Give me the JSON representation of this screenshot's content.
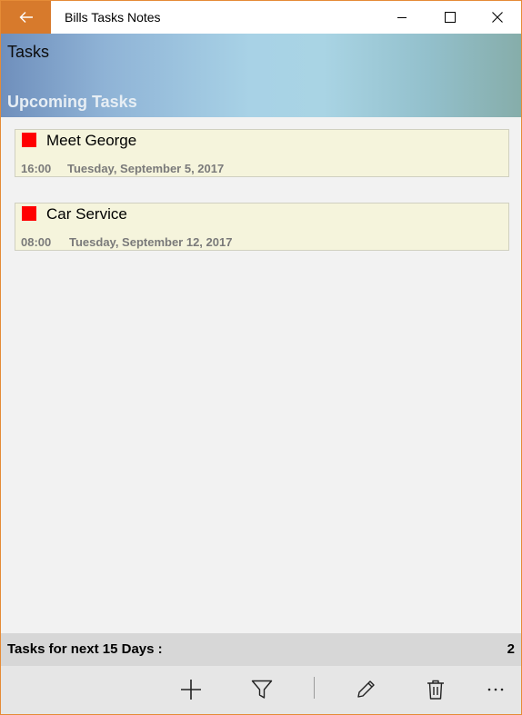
{
  "window": {
    "title": "Bills Tasks Notes"
  },
  "header": {
    "page_title": "Tasks",
    "section_title": "Upcoming Tasks"
  },
  "tasks": [
    {
      "name": "Meet George",
      "time": "16:00",
      "date": "Tuesday, September 5, 2017",
      "flag_color": "#ff0000"
    },
    {
      "name": "Car Service",
      "time": "08:00",
      "date": "Tuesday, September 12, 2017",
      "flag_color": "#ff0000"
    }
  ],
  "summary": {
    "label": "Tasks for next 15 Days :",
    "count": "2"
  },
  "appbar": {
    "icons": [
      "add-icon",
      "filter-icon",
      "edit-icon",
      "delete-icon",
      "more-icon"
    ]
  },
  "colors": {
    "accent": "#d77a2c",
    "card_background": "#f5f4dc",
    "flag": "#ff0000"
  }
}
